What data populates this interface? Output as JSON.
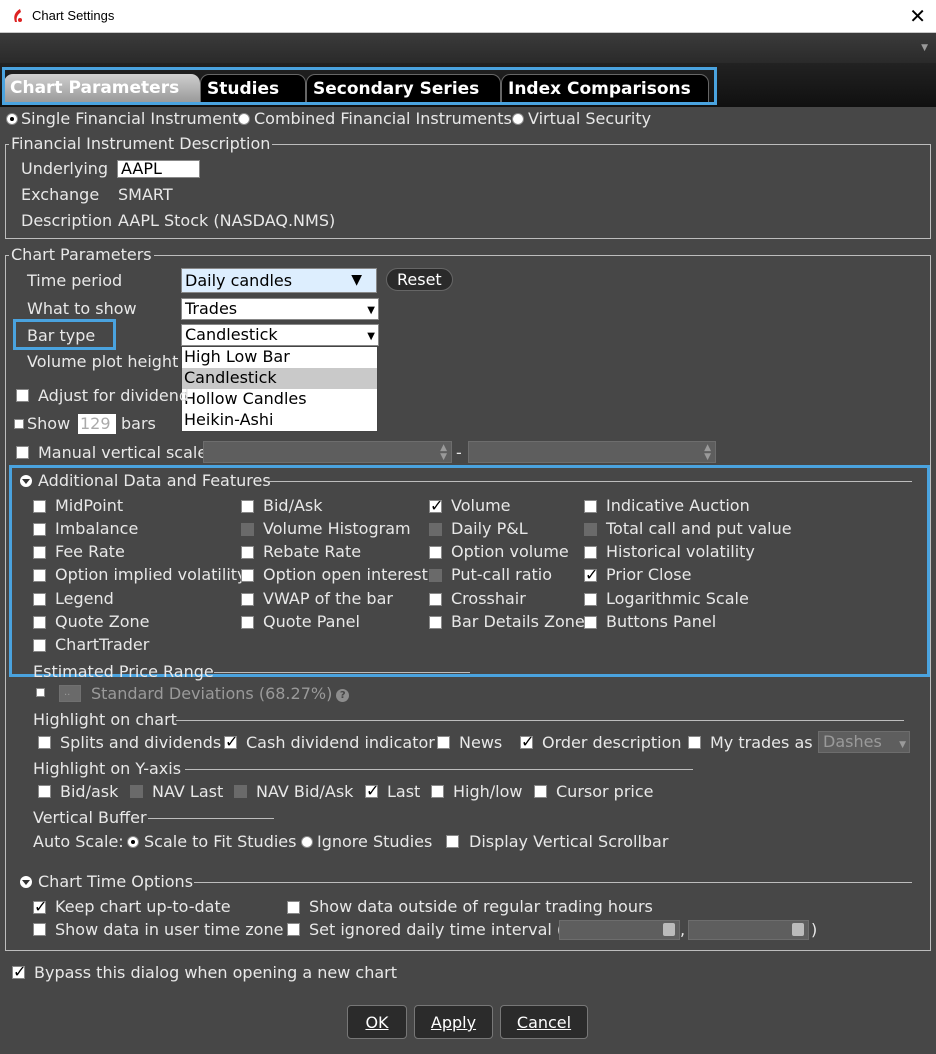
{
  "window": {
    "title": "Chart Settings",
    "close_glyph": "✕",
    "logo_icon": "app-logo-icon"
  },
  "tabs": [
    "Chart Parameters",
    "Studies",
    "Secondary Series",
    "Index Comparisons"
  ],
  "instrument_type": {
    "options": [
      "Single Financial Instrument",
      "Combined Financial Instruments",
      "Virtual Security"
    ],
    "selected": 0
  },
  "instrument": {
    "legend": "Financial Instrument Description",
    "underlying_label": "Underlying",
    "underlying_value": "AAPL",
    "exchange_label": "Exchange",
    "exchange_value": "SMART",
    "description_label": "Description",
    "description_value": "AAPL Stock (NASDAQ.NMS)"
  },
  "chart_params": {
    "legend": "Chart Parameters",
    "time_period_label": "Time period",
    "time_period_value": "Daily candles",
    "reset_label": "Reset",
    "what_to_show_label": "What to show",
    "what_to_show_value": "Trades",
    "bar_type_label": "Bar type",
    "bar_type_value": "Candlestick",
    "bar_type_options": [
      "High Low Bar",
      "Candlestick",
      "Hollow Candles",
      "Heikin-Ashi"
    ],
    "volume_plot_label": "Volume plot height",
    "adjust_dividends_label": "Adjust for dividend",
    "show_label": "Show",
    "show_value": "129",
    "bars_label": "bars",
    "manual_scale_label": "Manual vertical scale",
    "scale_sep": "-"
  },
  "additional": {
    "title": "Additional Data and Features",
    "items": [
      {
        "label": "MidPoint",
        "checked": false,
        "disabled": false
      },
      {
        "label": "Bid/Ask",
        "checked": false,
        "disabled": false
      },
      {
        "label": "Volume",
        "checked": true,
        "disabled": false
      },
      {
        "label": "Indicative Auction",
        "checked": false,
        "disabled": false
      },
      {
        "label": "Imbalance",
        "checked": false,
        "disabled": false
      },
      {
        "label": "Volume Histogram",
        "checked": false,
        "disabled": true
      },
      {
        "label": "Daily P&L",
        "checked": false,
        "disabled": true
      },
      {
        "label": "Total call and put value",
        "checked": false,
        "disabled": true
      },
      {
        "label": "Fee Rate",
        "checked": false,
        "disabled": false
      },
      {
        "label": "Rebate Rate",
        "checked": false,
        "disabled": false
      },
      {
        "label": "Option volume",
        "checked": false,
        "disabled": false
      },
      {
        "label": "Historical volatility",
        "checked": false,
        "disabled": false
      },
      {
        "label": "Option implied volatility",
        "checked": false,
        "disabled": false
      },
      {
        "label": "Option open interest",
        "checked": false,
        "disabled": false
      },
      {
        "label": "Put-call ratio",
        "checked": false,
        "disabled": true
      },
      {
        "label": "Prior Close",
        "checked": true,
        "disabled": false
      },
      {
        "label": "Legend",
        "checked": false,
        "disabled": false
      },
      {
        "label": "VWAP of the bar",
        "checked": false,
        "disabled": false
      },
      {
        "label": "Crosshair",
        "checked": false,
        "disabled": false
      },
      {
        "label": "Logarithmic Scale",
        "checked": false,
        "disabled": false
      },
      {
        "label": "Quote Zone",
        "checked": false,
        "disabled": false
      },
      {
        "label": "Quote Panel",
        "checked": false,
        "disabled": false
      },
      {
        "label": "Bar Details Zone",
        "checked": false,
        "disabled": false
      },
      {
        "label": "Buttons Panel",
        "checked": false,
        "disabled": false
      },
      {
        "label": "ChartTrader",
        "checked": false,
        "disabled": false
      }
    ]
  },
  "price_range": {
    "title": "Estimated Price Range",
    "dots": "..",
    "std_label": "Standard Deviations (68.27%)",
    "help_glyph": "?"
  },
  "highlight_chart": {
    "title": "Highlight on chart",
    "items": [
      {
        "label": "Splits and dividends",
        "checked": false
      },
      {
        "label": "Cash dividend indicator",
        "checked": true
      },
      {
        "label": "News",
        "checked": false
      },
      {
        "label": "Order description",
        "checked": true
      },
      {
        "label": "My trades as",
        "checked": false
      }
    ],
    "trades_style": "Dashes"
  },
  "highlight_y": {
    "title": "Highlight on Y-axis",
    "items": [
      {
        "label": "Bid/ask",
        "checked": false,
        "disabled": false
      },
      {
        "label": "NAV Last",
        "checked": false,
        "disabled": true
      },
      {
        "label": "NAV Bid/Ask",
        "checked": false,
        "disabled": true
      },
      {
        "label": "Last",
        "checked": true,
        "disabled": false
      },
      {
        "label": "High/low",
        "checked": false,
        "disabled": false
      },
      {
        "label": "Cursor price",
        "checked": false,
        "disabled": false
      }
    ]
  },
  "vertical_buffer": {
    "title": "Vertical Buffer",
    "auto_scale_label": "Auto Scale:",
    "fit_label": "Scale to Fit Studies",
    "ignore_label": "Ignore Studies",
    "scrollbar_label": "Display Vertical Scrollbar"
  },
  "time_options": {
    "title": "Chart Time Options",
    "keep_label": "Keep chart up-to-date",
    "keep_checked": true,
    "outside_label": "Show data outside of regular trading hours",
    "user_tz_label": "Show data in user time zone",
    "ignored_label": "Set ignored daily time interval (",
    "comma": ",",
    "close_paren": ")"
  },
  "bypass": {
    "label": "Bypass this dialog when opening a new chart",
    "checked": true
  },
  "buttons": {
    "ok": "OK",
    "apply": "Apply",
    "cancel": "Cancel"
  },
  "colors": {
    "accent": "#4aa3df",
    "background": "#474747"
  }
}
